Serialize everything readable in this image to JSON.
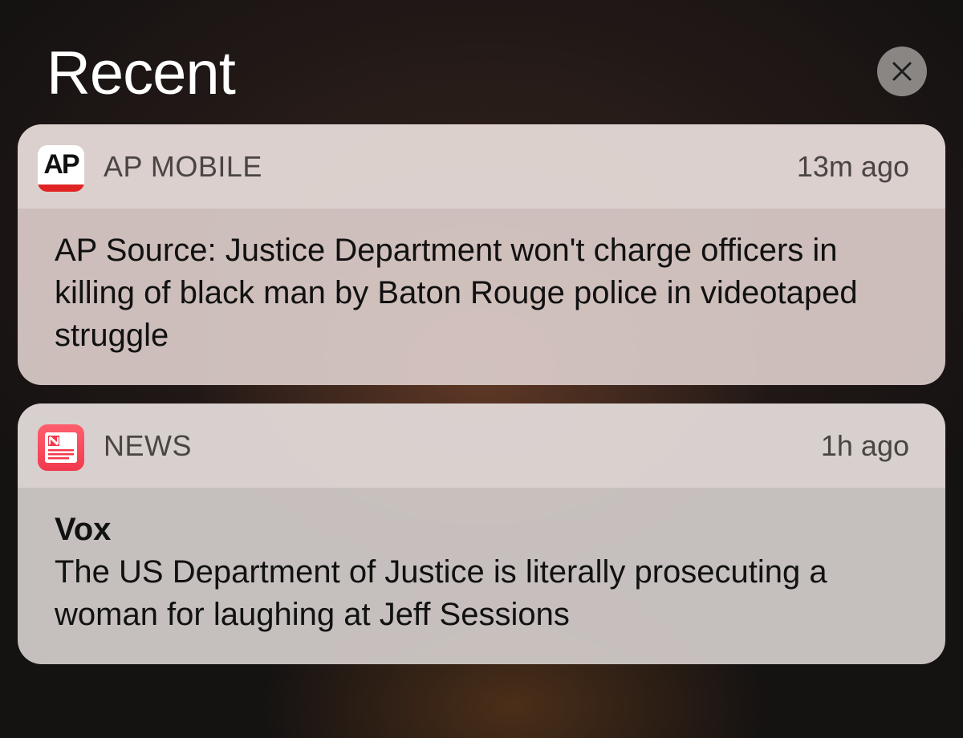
{
  "header": {
    "title": "Recent",
    "clear_icon": "close-icon"
  },
  "notifications": [
    {
      "app_icon": "ap-icon",
      "app_icon_text": "AP",
      "app_name": "AP MOBILE",
      "time": "13m ago",
      "title": "",
      "body": "AP Source: Justice Department won't charge officers in killing of black man by Baton Rouge police in videotaped struggle"
    },
    {
      "app_icon": "news-icon",
      "app_name": "NEWS",
      "time": "1h ago",
      "title": "Vox",
      "body": "The US Department of Justice is literally prosecuting a woman for laughing at Jeff Sessions"
    }
  ],
  "colors": {
    "ap_red": "#e02424",
    "news_red": "#f2394e",
    "clear_button": "#8a8684"
  }
}
